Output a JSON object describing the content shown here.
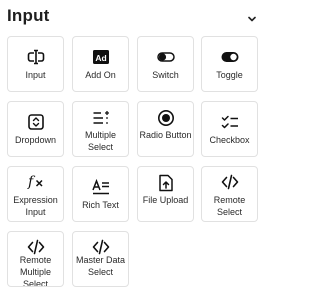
{
  "section": {
    "title": "Input",
    "collapse_icon": "chevron-down-icon"
  },
  "items": [
    {
      "label": "Input",
      "icon": "text-cursor-icon"
    },
    {
      "label": "Add On",
      "icon": "ad-icon"
    },
    {
      "label": "Switch",
      "icon": "switch-off-icon"
    },
    {
      "label": "Toggle",
      "icon": "toggle-on-icon"
    },
    {
      "label": "Dropdown",
      "icon": "dropdown-icon"
    },
    {
      "label": "Multiple Select",
      "icon": "multi-list-icon"
    },
    {
      "label": "Radio Button",
      "icon": "radio-icon"
    },
    {
      "label": "Checkbox",
      "icon": "checklist-icon"
    },
    {
      "label": "Expression Input",
      "icon": "function-icon"
    },
    {
      "label": "Rich Text",
      "icon": "rich-text-icon"
    },
    {
      "label": "File Upload",
      "icon": "file-upload-icon"
    },
    {
      "label": "Remote Select",
      "icon": "code-icon"
    },
    {
      "label": "Remote Multiple Select",
      "icon": "code-icon"
    },
    {
      "label": "Master Data Select",
      "icon": "code-icon"
    }
  ]
}
